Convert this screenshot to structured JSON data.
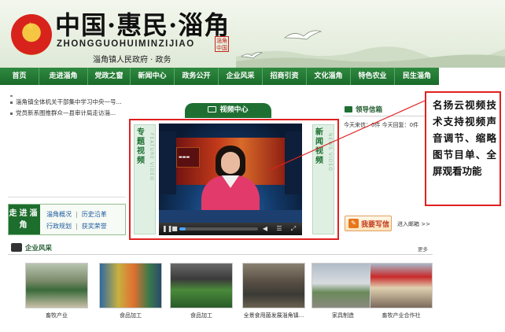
{
  "header": {
    "title": "中国·惠民·淄角",
    "pinyin": "ZHONGGUOHUIMINZIJIAO",
    "subtitle": "淄角镇人民政府 · 政务",
    "seal_text": "淄角中国"
  },
  "nav": {
    "items": [
      "首页",
      "走进淄角",
      "党政之窗",
      "新闻中心",
      "政务公开",
      "企业风采",
      "招商引资",
      "文化淄角",
      "特色农业",
      "民生淄角"
    ]
  },
  "news": {
    "items": [
      "淄角镇全体机关干部集中学习中央一号...",
      "党员新系图推群众—县审计局走访淄..."
    ]
  },
  "enter": {
    "label": "走进淄角",
    "links": [
      [
        "淄角概况",
        "历史沿革"
      ],
      [
        "行政规划",
        "获奖荣誉"
      ]
    ]
  },
  "video_center": {
    "tab_label": "视频中心",
    "left_panel": {
      "cn": "专题视频",
      "en": "FEATURE VIDEO"
    },
    "right_panel": {
      "cn": "新闻视频",
      "en": "NEWS VIDEO"
    },
    "progress": 0.08
  },
  "mailbox": {
    "title": "领导信箱",
    "stats": "今天来信：0件  今天回复：0件",
    "write_label": "我要写信",
    "enter_link": "进入邮箱 >>"
  },
  "callout": {
    "text": "名扬云视频技术支持视频声音调节、缩略图节目单、全屏观看功能"
  },
  "enterprise": {
    "title": "企业风采",
    "more": "更多",
    "photos": [
      "畜牧产业",
      "食品加工",
      "食品加工",
      "全景食用菌发展淄角镇...",
      "家具制造",
      "畜牧产业合作社"
    ]
  },
  "colors": {
    "nav_green": "#1f6f33",
    "highlight_red": "#e02020",
    "link_blue": "#1d5a9e"
  }
}
